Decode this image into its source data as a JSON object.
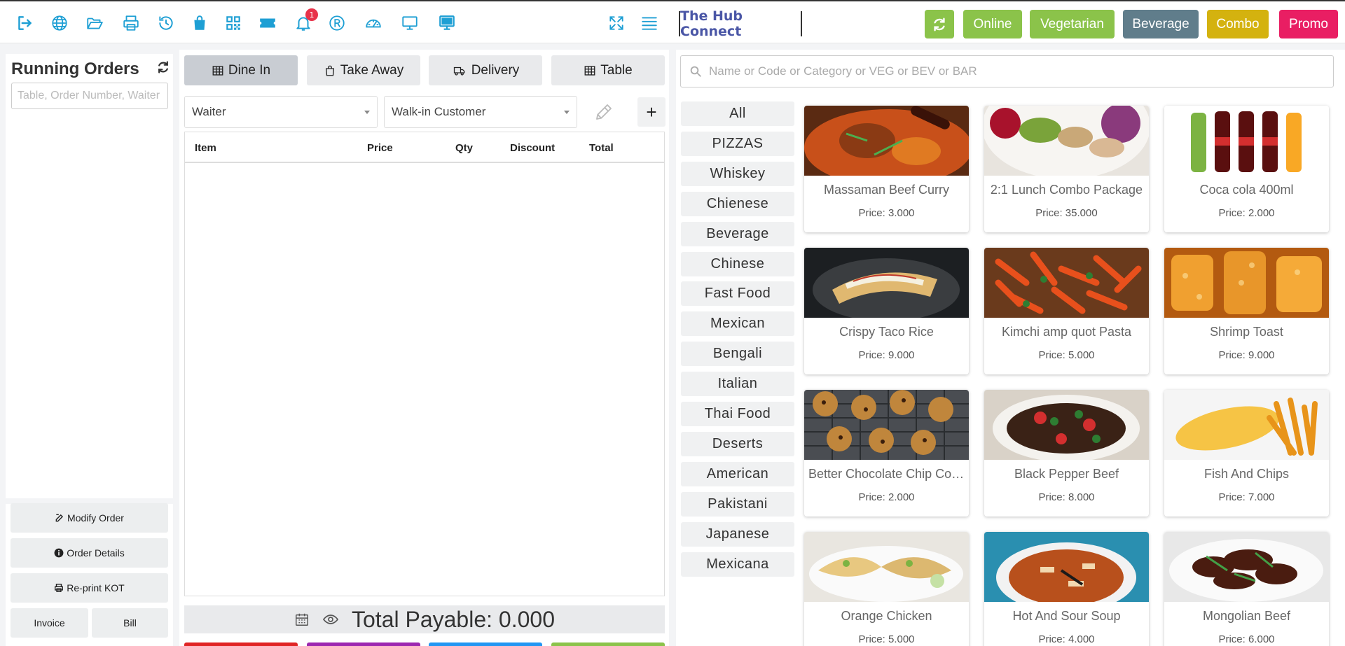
{
  "toolbar": {
    "notification_count": "1",
    "brand": "The Hub Connect",
    "pills": [
      {
        "label": "Online",
        "color": "#8bc34a"
      },
      {
        "label": "Vegetarian",
        "color": "#8bc34a"
      },
      {
        "label": "Beverage",
        "color": "#607d8b"
      },
      {
        "label": "Combo",
        "color": "#d4b20f"
      },
      {
        "label": "Promo",
        "color": "#e91e63"
      }
    ],
    "accent_color": "#1e9fd4"
  },
  "running_orders": {
    "title": "Running Orders",
    "search_placeholder": "Table, Order Number, Waiter",
    "buttons": {
      "modify": "Modify Order",
      "details": "Order Details",
      "reprint": "Re-print KOT",
      "invoice": "Invoice",
      "bill": "Bill"
    }
  },
  "order": {
    "tabs": [
      "Dine In",
      "Take Away",
      "Delivery",
      "Table"
    ],
    "waiter_select": "Waiter",
    "customer_select": "Walk-in Customer",
    "columns": [
      "Item",
      "Price",
      "Qty",
      "Discount",
      "Total"
    ],
    "total_label": "Total Payable: 0.000",
    "action_colors": [
      "#e02424",
      "#9c27b0",
      "#2196f3",
      "#8bc34a"
    ]
  },
  "menu": {
    "search_placeholder": "Name or Code or Category or VEG or BEV or BAR",
    "categories": [
      "All",
      "PIZZAS",
      "Whiskey",
      "Chienese",
      "Beverage",
      "Chinese",
      "Fast Food",
      "Mexican",
      "Bengali",
      "Italian",
      "Thai Food",
      "Deserts",
      "American",
      "Pakistani",
      "Japanese",
      "Mexicana"
    ],
    "items": [
      {
        "name": "Massaman Beef Curry",
        "price": "Price: 3.000"
      },
      {
        "name": "2:1 Lunch Combo Package",
        "price": "Price: 35.000"
      },
      {
        "name": "Coca cola 400ml",
        "price": "Price: 2.000"
      },
      {
        "name": "Crispy Taco Rice",
        "price": "Price: 9.000"
      },
      {
        "name": "Kimchi amp quot Pasta",
        "price": "Price: 5.000"
      },
      {
        "name": "Shrimp Toast",
        "price": "Price: 9.000"
      },
      {
        "name": "Better Chocolate Chip Cookies",
        "price": "Price: 2.000"
      },
      {
        "name": "Black Pepper Beef",
        "price": "Price: 8.000"
      },
      {
        "name": "Fish And Chips",
        "price": "Price: 7.000"
      },
      {
        "name": "Orange Chicken",
        "price": "Price: 5.000"
      },
      {
        "name": "Hot And Sour Soup",
        "price": "Price: 4.000"
      },
      {
        "name": "Mongolian Beef",
        "price": "Price: 6.000"
      }
    ]
  }
}
